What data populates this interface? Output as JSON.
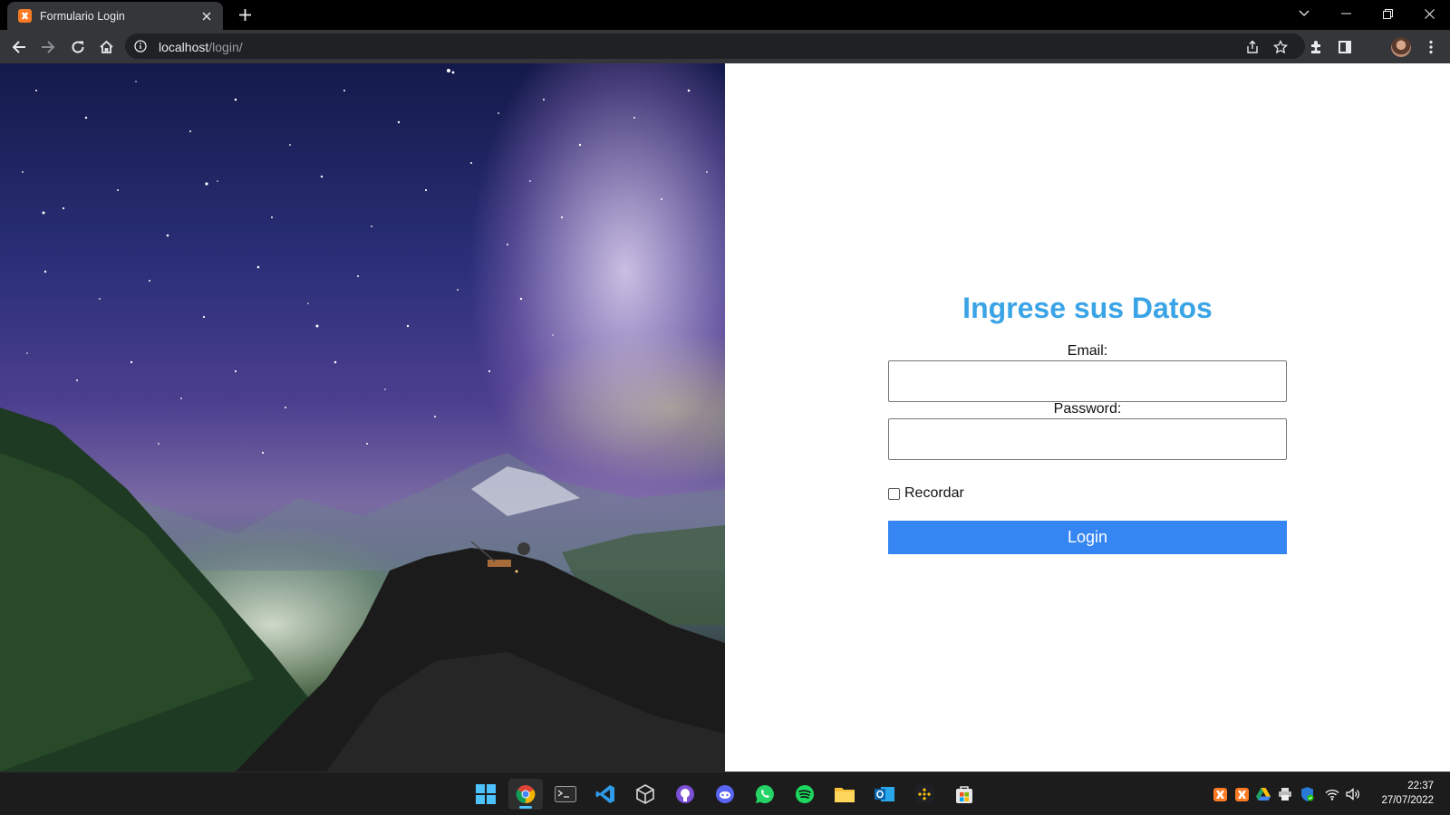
{
  "browser": {
    "tab_title": "Formulario Login",
    "url_host": "localhost",
    "url_path": "/login/"
  },
  "form": {
    "title": "Ingrese sus Datos",
    "email_label": "Email:",
    "email_value": "",
    "password_label": "Password:",
    "password_value": "",
    "remember_label": "Recordar",
    "remember_checked": false,
    "login_button": "Login"
  },
  "taskbar": {
    "apps": [
      "windows-start",
      "chrome",
      "terminal",
      "vscode",
      "virtualbox",
      "github-desktop",
      "discord",
      "whatsapp",
      "spotify",
      "file-explorer",
      "outlook",
      "binance",
      "microsoft-store"
    ],
    "active_app": "chrome",
    "tray": [
      "xampp",
      "xampp",
      "google-drive",
      "printer",
      "windows-security",
      "wifi",
      "volume"
    ],
    "time": "22:37",
    "date": "27/07/2022"
  },
  "colors": {
    "title_blue": "#3aa4e6",
    "button_blue": "#3585f2",
    "favicon_orange": "#fb7a24"
  }
}
